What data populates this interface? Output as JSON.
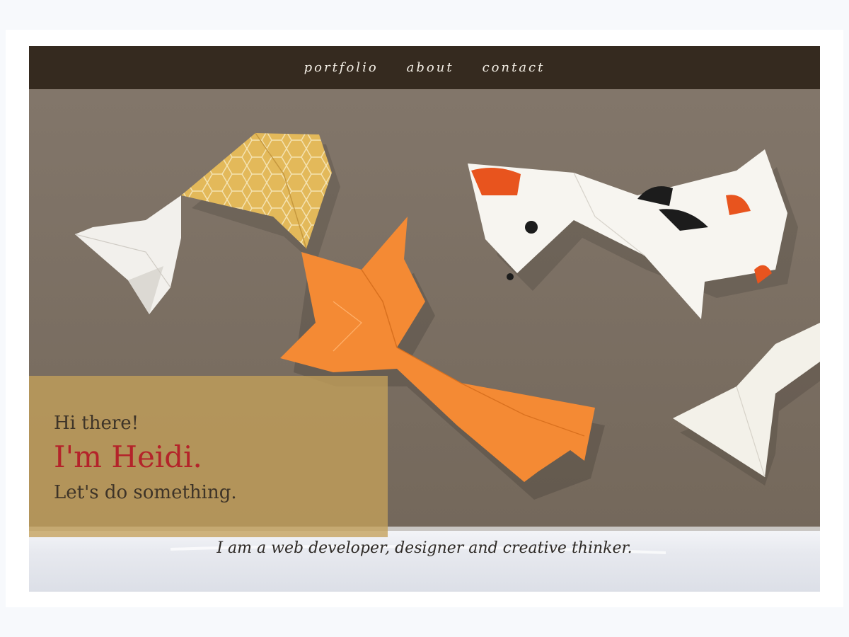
{
  "nav": {
    "items": [
      {
        "label": "portfolio"
      },
      {
        "label": "about"
      },
      {
        "label": "contact"
      }
    ]
  },
  "hero": {
    "greeting": "Hi there!",
    "name": "I'm Heidi.",
    "cta": "Let's do something.",
    "tagline": "I am a web developer, designer and creative thinker."
  },
  "colors": {
    "nav_bg": "#352a1f",
    "wall": "#7d7164",
    "intro_box": "#c4a05a",
    "name_accent": "#b4232a"
  }
}
